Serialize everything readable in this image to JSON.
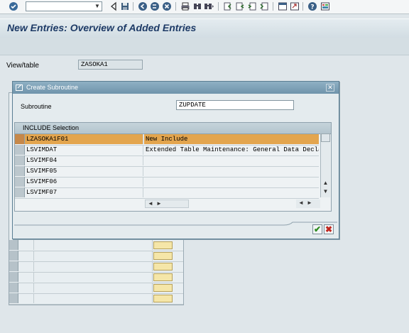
{
  "toolbar": {
    "command_field_value": "",
    "icons": [
      "enter-icon",
      "save-icon",
      "back-icon",
      "exit-icon",
      "cancel-icon",
      "print-icon",
      "find-icon",
      "find-next-icon",
      "first-page-icon",
      "previous-page-icon",
      "next-page-icon",
      "last-page-icon",
      "create-session-icon",
      "shortcut-icon",
      "help-icon",
      "layout-menu-icon"
    ]
  },
  "header": {
    "title": "New Entries: Overview of Added Entries"
  },
  "view": {
    "label": "View/table",
    "value": "ZASOKA1"
  },
  "dialog": {
    "title": "Create Subroutine",
    "subroutine_label": "Subroutine",
    "subroutine_value": "ZUPDATE",
    "include_section_title": "INCLUDE Selection",
    "rows": [
      {
        "name": "LZASOKA1F01",
        "desc": "New Include",
        "selected": true
      },
      {
        "name": "LSVIMDAT",
        "desc": "Extended Table Maintenance: General Data Decla",
        "selected": false
      },
      {
        "name": "LSVIMF04",
        "desc": "",
        "selected": false
      },
      {
        "name": "LSVIMF05",
        "desc": "",
        "selected": false
      },
      {
        "name": "LSVIMF06",
        "desc": "",
        "selected": false
      },
      {
        "name": "LSVIMF07",
        "desc": "",
        "selected": false
      }
    ],
    "ok_icon": "checkmark-icon",
    "cancel_icon": "cancel-x-icon"
  },
  "colors": {
    "highlight": "#e3a54e",
    "title_text": "#1d3a66",
    "dialog_title_bar": "#7a9db3"
  }
}
